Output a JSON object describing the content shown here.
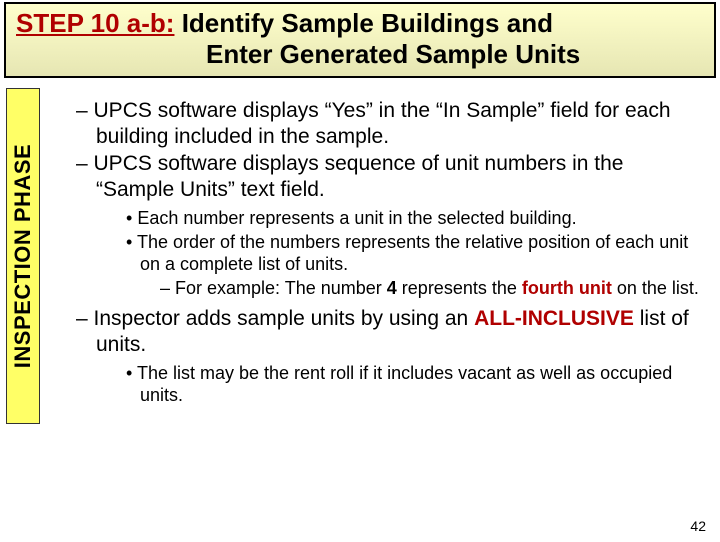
{
  "header": {
    "step_label": "STEP 10 a-b:",
    "title_rest": " Identify Sample Buildings and",
    "title_line2": "Enter Generated Sample Units"
  },
  "sidebar": {
    "label": "INSPECTION PHASE"
  },
  "content": {
    "d1": "UPCS software displays “Yes” in the “In Sample” field for each building included in the sample.",
    "d2": "UPCS software displays sequence of unit numbers in the “Sample Units” text field.",
    "b1": "Each number represents a unit in the selected building.",
    "b2": "The order of the numbers represents the relative position of each unit on a complete list of units.",
    "sd1_a": "For example: The number ",
    "sd1_num": "4",
    "sd1_b": " represents the ",
    "sd1_highlight": "fourth unit",
    "sd1_c": " on the list.",
    "d3_a": "Inspector adds sample units by using an ",
    "d3_highlight": "ALL-INCLUSIVE",
    "d3_b": " list of units.",
    "b3": "The list may be the rent roll if it includes vacant as well as occupied units."
  },
  "page_number": "42"
}
